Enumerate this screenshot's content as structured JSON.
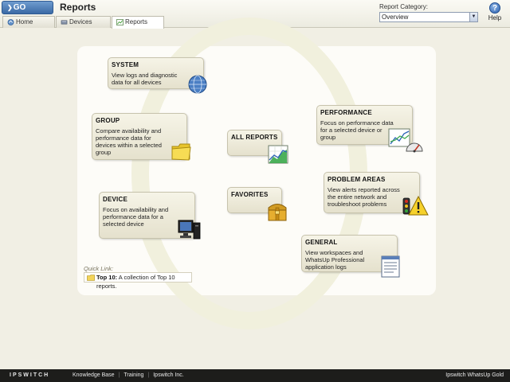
{
  "header": {
    "go_label": "GO",
    "page_title": "Reports",
    "tabs": [
      {
        "label": "Home",
        "icon": "home-icon"
      },
      {
        "label": "Devices",
        "icon": "devices-icon"
      },
      {
        "label": "Reports",
        "icon": "reports-icon",
        "active": true
      }
    ],
    "report_category_label": "Report Category:",
    "report_category_value": "Overview",
    "help_label": "Help"
  },
  "cards": {
    "system": {
      "title": "SYSTEM",
      "desc": "View logs and diagnostic data for all devices",
      "icon": "globe-icon"
    },
    "group": {
      "title": "GROUP",
      "desc": "Compare availability and performance data for devices within a selected group",
      "icon": "folder-icon"
    },
    "device": {
      "title": "DEVICE",
      "desc": "Focus on availability and performance data for a selected device",
      "icon": "computer-icon"
    },
    "all_reports": {
      "title": "ALL REPORTS",
      "icon": "chart-icon"
    },
    "favorites": {
      "title": "FAVORITES",
      "icon": "treasure-chest-icon"
    },
    "performance": {
      "title": "PERFORMANCE",
      "desc": "Focus on performance data for a selected device or group",
      "icon": "gauge-chart-icon"
    },
    "problem_areas": {
      "title": "PROBLEM AREAS",
      "desc": "View alerts reported across the entire network and troubleshoot problems",
      "icon": "warning-traffic-light-icon"
    },
    "general": {
      "title": "GENERAL",
      "desc": "View workspaces and WhatsUp Professional application logs",
      "icon": "document-icon"
    }
  },
  "quick_link": {
    "label": "Quick Link:",
    "title": "Top 10:",
    "text": " A collection of Top 10 reports."
  },
  "footer": {
    "brand": "IPSWITCH",
    "links": [
      "Knowledge Base",
      "Training",
      "Ipswitch Inc."
    ],
    "product": "Ipswitch WhatsUp Gold"
  },
  "colors": {
    "accent": "#3b6aa5",
    "background": "#f1efe4",
    "card": "#ece9d8",
    "footer": "#1d1d1b"
  }
}
